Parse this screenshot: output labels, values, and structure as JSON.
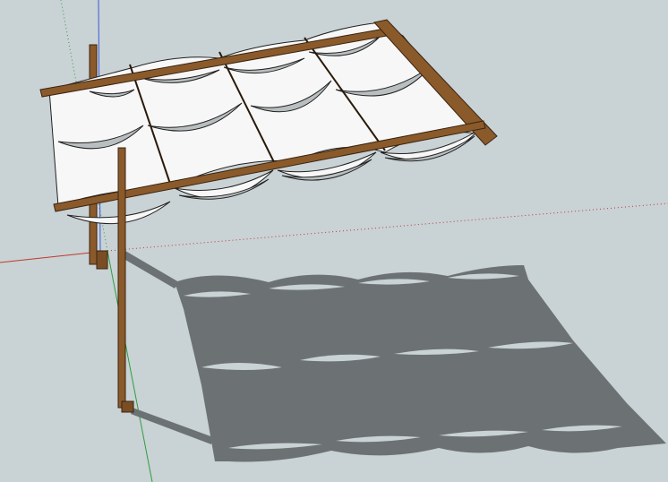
{
  "scene": {
    "background_color": "#c9d2d5",
    "shadow_color": "#6c7273",
    "canopy_fabric_color": "#f7f7f7",
    "canopy_underside_color": "#b9bfc0",
    "wood_color": "#8a5a2b",
    "wood_dark_color": "#5a3517",
    "axis_red": "#c0392b",
    "axis_green": "#2e9e3e",
    "axis_blue": "#3a5bd9"
  }
}
